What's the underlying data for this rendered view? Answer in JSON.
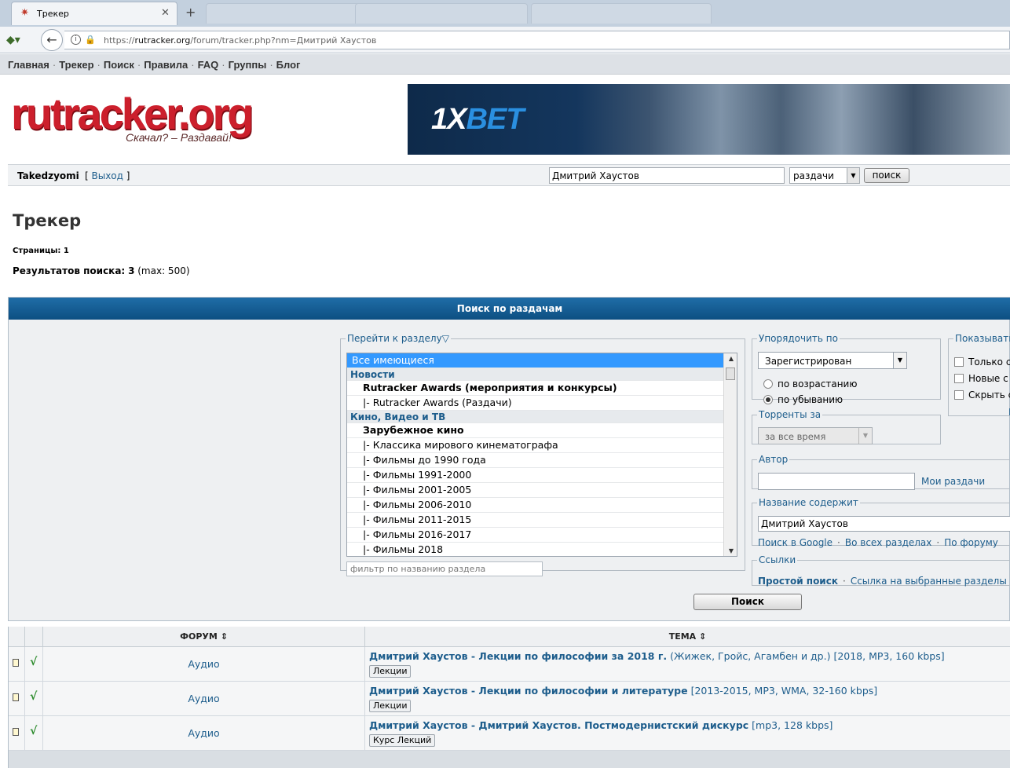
{
  "browser": {
    "tab_title": "Трекер",
    "url_prefix": "https://",
    "url_host": "rutracker.org",
    "url_path": "/forum/tracker.php?nm=Дмитрий Хаустов"
  },
  "site_nav": [
    "Главная",
    "Трекер",
    "Поиск",
    "Правила",
    "FAQ",
    "Группы",
    "Блог"
  ],
  "logo": {
    "word": "rutracker.org",
    "slogan": "Скачал? – Раздавай!"
  },
  "banner": {
    "brand_a": "1X",
    "brand_b": "BET"
  },
  "userbar": {
    "username": "Takedzyomi",
    "logout_label": "Выход",
    "search_value": "Дмитрий Хаустов",
    "search_scope": "раздачи",
    "search_button": "поиск"
  },
  "page": {
    "title": "Трекер",
    "pages_label": "Страницы:",
    "pages_value": "1",
    "results_label": "Результатов поиска:",
    "results_count": "3",
    "results_max": "(max: 500)"
  },
  "panel": {
    "header": "Поиск по раздачам",
    "forum_legend": "Перейти к разделу",
    "forum_options": [
      {
        "kind": "sel",
        "label": "Все имеющиеся"
      },
      {
        "kind": "cat",
        "label": "Новости"
      },
      {
        "kind": "sub",
        "label": "Rutracker Awards (мероприятия и конкурсы)"
      },
      {
        "kind": "leaf",
        "label": "|- Rutracker Awards (Раздачи)"
      },
      {
        "kind": "cat",
        "label": "Кино, Видео и ТВ"
      },
      {
        "kind": "sub",
        "label": "Зарубежное кино"
      },
      {
        "kind": "leaf",
        "label": "|- Классика мирового кинематографа"
      },
      {
        "kind": "leaf",
        "label": "|- Фильмы до 1990 года"
      },
      {
        "kind": "leaf",
        "label": "|- Фильмы 1991-2000"
      },
      {
        "kind": "leaf",
        "label": "|- Фильмы 2001-2005"
      },
      {
        "kind": "leaf",
        "label": "|- Фильмы 2006-2010"
      },
      {
        "kind": "leaf",
        "label": "|- Фильмы 2011-2015"
      },
      {
        "kind": "leaf",
        "label": "|- Фильмы 2016-2017"
      },
      {
        "kind": "leaf",
        "label": "|- Фильмы 2018"
      }
    ],
    "forum_filter_placeholder": "фильтр по названию раздела",
    "order_legend": "Упорядочить по",
    "order_value": "Зарегистрирован",
    "order_asc": "по возрастанию",
    "order_desc": "по убыванию",
    "show_legend": "Показывать",
    "show_options": [
      "Только с",
      "Новые с",
      "Скрыть с"
    ],
    "show_extra": "Е",
    "period_legend": "Торренты за",
    "period_value": "за все время",
    "author_legend": "Автор",
    "my_releases": "Мои раздачи",
    "title_legend": "Название содержит",
    "title_value": "Дмитрий Хаустов",
    "title_links": [
      "Поиск в Google",
      "Во всех разделах",
      "По форуму"
    ],
    "links_legend": "Ссылки",
    "links_simple": "Простой поиск",
    "links_selected": "Ссылка на выбранные разделы",
    "submit": "Поиск"
  },
  "table": {
    "col_forum": "ФОРУМ",
    "col_topic": "ТЕМА",
    "sort_glyph": "⇕",
    "rows": [
      {
        "forum": "Аудио",
        "title": "Дмитрий Хаустов - Лекции по философии за 2018 г.",
        "meta": "(Жижек, Гройс, Агамбен и др.) [2018, MP3, 160 kbps]",
        "tag": "Лекции"
      },
      {
        "forum": "Аудио",
        "title": "Дмитрий Хаустов - Лекции по философии и литературе",
        "meta": "[2013-2015, MP3, WMA, 32-160 kbps]",
        "tag": "Лекции"
      },
      {
        "forum": "Аудио",
        "title": "Дмитрий Хаустов - Дмитрий Хаустов. Постмодернистский дискурс",
        "meta": "[mp3, 128 kbps]",
        "tag": "Курс Лекций"
      }
    ]
  }
}
